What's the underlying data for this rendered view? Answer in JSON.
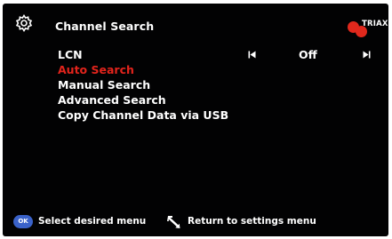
{
  "header": {
    "title": "Channel Search",
    "brand": "TRIAX",
    "settings_icon": "gear-icon",
    "brand_color": "#e0281c"
  },
  "menu": {
    "items": [
      {
        "label": "LCN",
        "selected": false
      },
      {
        "label": "Auto Search",
        "selected": true
      },
      {
        "label": "Manual Search",
        "selected": false
      },
      {
        "label": "Advanced Search",
        "selected": false
      },
      {
        "label": "Copy Channel Data via USB",
        "selected": false
      }
    ],
    "selected_color": "#e3241c"
  },
  "lcn": {
    "value": "Off",
    "prev_icon": "skip-previous-icon",
    "next_icon": "skip-next-icon"
  },
  "footer": {
    "ok_label": "OK",
    "ok_hint": "Select desired menu",
    "back_hint": "Return to settings menu",
    "back_icon": "return-icon",
    "ok_color": "#3a62c9"
  }
}
